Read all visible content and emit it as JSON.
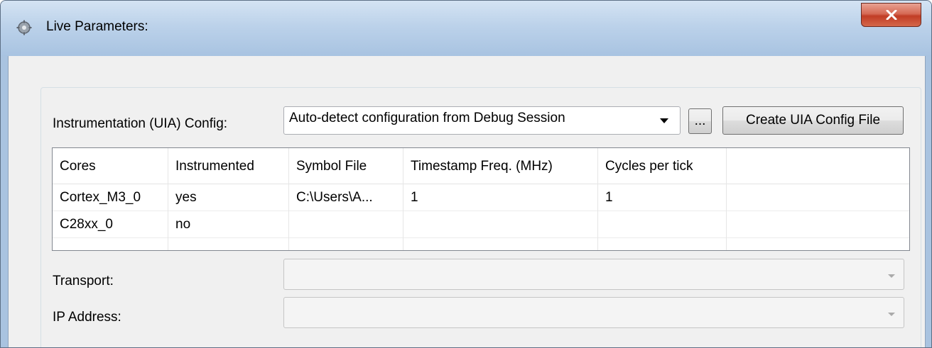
{
  "window": {
    "title": "Live Parameters:",
    "app_icon": "gear-icon",
    "close_glyph": "✕"
  },
  "config": {
    "label": "Instrumentation (UIA) Config:",
    "value": "Auto-detect configuration from Debug Session",
    "browse_label": "...",
    "create_label": "Create UIA Config File"
  },
  "table": {
    "columns": [
      "Cores",
      "Instrumented",
      "Symbol File",
      "Timestamp Freq. (MHz)",
      "Cycles per tick",
      ""
    ],
    "rows": [
      [
        "Cortex_M3_0",
        "yes",
        "C:\\Users\\A...",
        "1",
        "1",
        ""
      ],
      [
        "C28xx_0",
        "no",
        "",
        "",
        "",
        ""
      ]
    ]
  },
  "transport": {
    "label": "Transport:",
    "value": ""
  },
  "ip_address": {
    "label": "IP Address:",
    "value": ""
  },
  "colors": {
    "close_button": "#c13d25",
    "titlebar": "#bcd2ea",
    "client_bg": "#f0f0f0"
  }
}
